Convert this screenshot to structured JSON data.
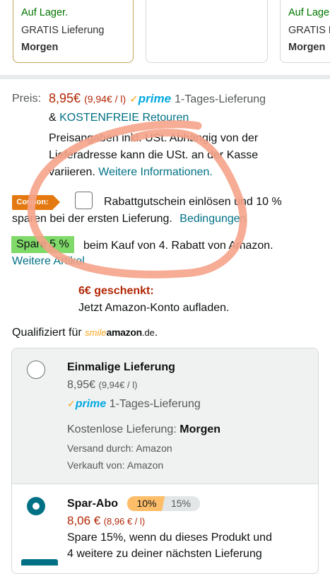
{
  "offers": [
    {
      "status": "Auf Lager.",
      "shipping": "GRATIS Lieferung",
      "when": "Morgen"
    },
    {
      "status": "",
      "shipping": "",
      "when": ""
    },
    {
      "status": "Auf Lage",
      "shipping": "GRATIS L",
      "when": "Morgen"
    }
  ],
  "price": {
    "label": "Preis:",
    "value": "8,95€",
    "unit": "(9,94€ / l)",
    "prime_check": "✓",
    "prime_word": "prime",
    "delivery": "1-Tages-Lieferung",
    "and": "&",
    "returns_link": "KOSTENFREIE Retouren",
    "tax_line1": "Preisangaben inkl. USt. Abhängig von der",
    "tax_line2": "Lieferadresse kann die USt. an der Kasse",
    "tax_line3": "variieren.",
    "more_info_link": "Weitere Informationen."
  },
  "coupon": {
    "badge": "Coupon:",
    "text1": "Rabattgutschein einlösen und 10 %",
    "text2": "sparen bei der ersten Lieferung.",
    "conditions_link": "Bedingungen"
  },
  "discount": {
    "badge": "Spare 5 %",
    "text": "beim Kauf von 4. Rabatt von Amazon.",
    "more_link": "Weitere Artikel"
  },
  "gift": {
    "title": "6€ geschenkt:",
    "text": "Jetzt Amazon-Konto aufladen."
  },
  "smile": {
    "text": "Qualifiziert für",
    "logo_smile": "smile",
    "logo_amazon": "amazon",
    "logo_de": ".de",
    "suffix": "."
  },
  "purchase_options": {
    "one_time": {
      "title": "Einmalige Lieferung",
      "price": "8,95€",
      "unit": "(9,94€ / l)",
      "prime_check": "✓",
      "prime_word": "prime",
      "delivery": "1-Tages-Lieferung",
      "free_label": "Kostenlose Lieferung:",
      "free_when": "Morgen",
      "shipped_by": "Versand durch: Amazon",
      "sold_by": "Verkauft von: Amazon",
      "selected": false
    },
    "subscribe": {
      "title": "Spar-Abo",
      "pill1": "10%",
      "pill2": "15%",
      "price": "8,06 €",
      "unit": "(8,96 € / l)",
      "desc1": "Spare 15%, wenn du dieses Produkt und",
      "desc2": "4 weitere zu deiner nächsten Lieferung",
      "selected": true
    }
  },
  "colors": {
    "price": "#b12704",
    "link": "#007185",
    "in_stock": "#007600",
    "coupon": "#e47911",
    "spare": "#7fda69",
    "annotation": "#f5a38a"
  }
}
